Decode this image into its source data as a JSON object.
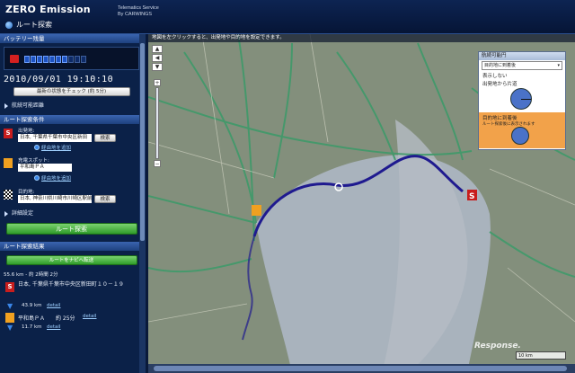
{
  "header": {
    "brand": "ZERO Emission",
    "service_line1": "Telematics Service",
    "service_line2": "By CARWINGS",
    "page_title": "ルート探索"
  },
  "battery": {
    "section_title": "バッテリー残量",
    "level_segments": 10,
    "level_filled": 7,
    "datetime": "2010/09/01 19:10:10",
    "refresh_button": "最新の状態をチェック (約 5分)"
  },
  "range": {
    "label": "航続可能距離"
  },
  "route_conditions": {
    "section_title": "ルート探索条件",
    "origin_label": "出発地:",
    "origin_value": "日本, 千葉県千葉市中央区新田",
    "search_button": "検索",
    "add_waypoint": "経由地を追加",
    "charge_label": "充電スポット:",
    "charge_value": "平和島ＰＡ",
    "add_waypoint2": "経由地を追加",
    "destination_label": "目的地:",
    "destination_value": "日本, 神奈川県川崎市川崎区駅前",
    "search_button2": "検索",
    "detail_settings": "詳細設定",
    "route_search_button": "ルート探索"
  },
  "results": {
    "section_title": "ルート探索結果",
    "send_nav_button": "ルートをナビへ転送",
    "summary": "55.6 km - 約 2時間 2分",
    "stop1": "日本, 千葉県千葉市中央区新田町１０－１９",
    "leg1": "43.9 km",
    "leg1_detail": "detail",
    "stop2": "平和島ＰＡ",
    "stop2_time": "約 25分",
    "stop2_detail": "detail",
    "leg2": "11.7 km",
    "leg2_detail": "detail"
  },
  "map": {
    "hint": "地図を左クリックすると、出発地や目的地を設定できます。",
    "scale": "10 km",
    "watermark": "Response."
  },
  "range_panel": {
    "title": "航続可能円",
    "select_value": "目的地に到着後",
    "opt_none": "表示しない",
    "opt_oneway": "出発地から片道",
    "opt_after": "目的地に到着後",
    "opt_after_sub": "ルート探索後に表示されます"
  },
  "colors": {
    "route": "#1f1a8f",
    "accent_green": "#2f9c2a",
    "panel_orange": "#f2a24a"
  }
}
